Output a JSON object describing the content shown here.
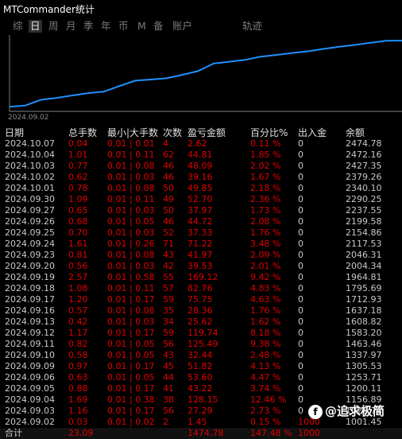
{
  "window": {
    "title": "MTCommander统计"
  },
  "tabs": [
    {
      "label": "综",
      "active": false
    },
    {
      "label": "日",
      "active": true
    },
    {
      "label": "周",
      "active": false
    },
    {
      "label": "月",
      "active": false
    },
    {
      "label": "季",
      "active": false
    },
    {
      "label": "年",
      "active": false
    },
    {
      "label": "币",
      "active": false
    },
    {
      "label": "M",
      "active": false
    },
    {
      "label": "备",
      "active": false
    },
    {
      "label": "账户",
      "active": false
    },
    {
      "label": "轨迹",
      "active": false
    }
  ],
  "chart_data": {
    "type": "line",
    "x_label_shown": "2024.09.02",
    "x": [
      "2024.09.02",
      "2024.09.03",
      "2024.09.04",
      "2024.09.05",
      "2024.09.06",
      "2024.09.09",
      "2024.09.10",
      "2024.09.11",
      "2024.09.12",
      "2024.09.13",
      "2024.09.16",
      "2024.09.17",
      "2024.09.18",
      "2024.09.19",
      "2024.09.20",
      "2024.09.23",
      "2024.09.24",
      "2024.09.25",
      "2024.09.26",
      "2024.09.27",
      "2024.09.30",
      "2024.10.01",
      "2024.10.02",
      "2024.10.03",
      "2024.10.04",
      "2024.10.07"
    ],
    "values": [
      1001.45,
      1028.74,
      1156.89,
      1200.11,
      1253.71,
      1305.53,
      1337.97,
      1463.46,
      1583.2,
      1608.82,
      1637.18,
      1712.93,
      1795.69,
      1964.81,
      2004.34,
      2046.31,
      2117.53,
      2154.86,
      2199.58,
      2237.55,
      2290.25,
      2340.1,
      2379.26,
      2427.35,
      2472.16,
      2474.78
    ],
    "color": "#1e90ff",
    "grid": false
  },
  "table": {
    "headers": [
      "日期",
      "总手数",
      "最小|大手数",
      "次数",
      "盈亏金额",
      "百分比%",
      "出入金",
      "余额"
    ],
    "rows": [
      [
        "2024.10.07",
        "0.04",
        "0.01 | 0.01",
        "4",
        "2.62",
        "0.11 %",
        "0",
        "2474.78"
      ],
      [
        "2024.10.04",
        "1.01",
        "0.01 | 0.11",
        "62",
        "44.81",
        "1.85 %",
        "0",
        "2472.16"
      ],
      [
        "2024.10.03",
        "0.77",
        "0.01 | 0.08",
        "46",
        "48.09",
        "2.02 %",
        "0",
        "2427.35"
      ],
      [
        "2024.10.02",
        "0.62",
        "0.01 | 0.03",
        "46",
        "39.16",
        "1.67 %",
        "0",
        "2379.26"
      ],
      [
        "2024.10.01",
        "0.78",
        "0.01 | 0.08",
        "50",
        "49.85",
        "2.18 %",
        "0",
        "2340.10"
      ],
      [
        "2024.09.30",
        "1.09",
        "0.01 | 0.11",
        "49",
        "52.70",
        "2.36 %",
        "0",
        "2290.25"
      ],
      [
        "2024.09.27",
        "0.65",
        "0.01 | 0.03",
        "50",
        "37.97",
        "1.73 %",
        "0",
        "2237.55"
      ],
      [
        "2024.09.26",
        "0.68",
        "0.01 | 0.05",
        "46",
        "44.72",
        "2.08 %",
        "0",
        "2199.58"
      ],
      [
        "2024.09.25",
        "0.70",
        "0.01 | 0.03",
        "52",
        "37.33",
        "1.76 %",
        "0",
        "2154.86"
      ],
      [
        "2024.09.24",
        "1.61",
        "0.01 | 0.26",
        "71",
        "71.22",
        "3.48 %",
        "0",
        "2117.53"
      ],
      [
        "2024.09.23",
        "0.81",
        "0.01 | 0.08",
        "43",
        "41.97",
        "2.09 %",
        "0",
        "2046.31"
      ],
      [
        "2024.09.20",
        "0.56",
        "0.01 | 0.03",
        "42",
        "39.53",
        "2.01 %",
        "0",
        "2004.34"
      ],
      [
        "2024.09.19",
        "2.57",
        "0.01 | 0.58",
        "55",
        "169.12",
        "9.42 %",
        "0",
        "1964.81"
      ],
      [
        "2024.09.18",
        "1.08",
        "0.01 | 0.11",
        "57",
        "82.76",
        "4.83 %",
        "0",
        "1795.69"
      ],
      [
        "2024.09.17",
        "1.20",
        "0.01 | 0.17",
        "59",
        "75.75",
        "4.63 %",
        "0",
        "1712.93"
      ],
      [
        "2024.09.16",
        "0.57",
        "0.01 | 0.08",
        "35",
        "28.36",
        "1.76 %",
        "0",
        "1637.18"
      ],
      [
        "2024.09.13",
        "0.42",
        "0.01 | 0.03",
        "34",
        "25.62",
        "1.62 %",
        "0",
        "1608.82"
      ],
      [
        "2024.09.12",
        "1.17",
        "0.01 | 0.17",
        "59",
        "119.74",
        "8.18 %",
        "0",
        "1583.20"
      ],
      [
        "2024.09.11",
        "0.82",
        "0.01 | 0.05",
        "56",
        "125.49",
        "9.38 %",
        "0",
        "1463.46"
      ],
      [
        "2024.09.10",
        "0.58",
        "0.01 | 0.05",
        "43",
        "32.44",
        "2.48 %",
        "0",
        "1337.97"
      ],
      [
        "2024.09.09",
        "0.97",
        "0.01 | 0.17",
        "45",
        "51.82",
        "4.13 %",
        "0",
        "1305.53"
      ],
      [
        "2024.09.06",
        "0.63",
        "0.01 | 0.05",
        "44",
        "53.60",
        "4.47 %",
        "0",
        "1253.71"
      ],
      [
        "2024.09.05",
        "0.88",
        "0.01 | 0.17",
        "41",
        "43.22",
        "3.74 %",
        "0",
        "1200.11"
      ],
      [
        "2024.09.04",
        "1.69",
        "0.01 | 0.38",
        "38",
        "128.15",
        "12.46 %",
        "0",
        "1156.89"
      ],
      [
        "2024.09.03",
        "1.16",
        "0.01 | 0.17",
        "56",
        "27.29",
        "2.73 %",
        "0",
        "1028.74"
      ],
      [
        "2024.09.02",
        "0.03",
        "0.01 | 0.02",
        "2",
        "1.45",
        "0.15 %",
        "1000",
        "1001.45"
      ]
    ],
    "footer": [
      "合计",
      "23.09",
      "",
      "",
      "1474.78",
      "147.48 %",
      "1000",
      ""
    ]
  },
  "watermark": {
    "logo_char": "f",
    "text": "@追求极简"
  }
}
